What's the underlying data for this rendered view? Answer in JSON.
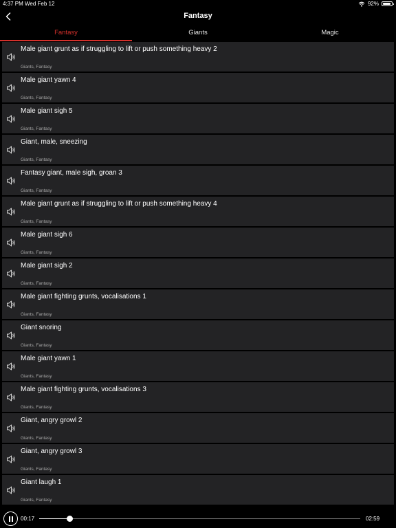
{
  "status_bar": {
    "time": "4:37 PM",
    "date": "Wed Feb 12",
    "battery": "92%",
    "battery_level": 0.92
  },
  "nav": {
    "title": "Fantasy",
    "back_icon": "chevron-left-icon"
  },
  "tabs": [
    {
      "label": "Fantasy",
      "active": true
    },
    {
      "label": "Giants",
      "active": false
    },
    {
      "label": "Magic",
      "active": false
    }
  ],
  "colors": {
    "accent": "#d6312c",
    "row_background": "#232325",
    "background": "#000000"
  },
  "sounds": [
    {
      "title": "Male giant grunt as if struggling to lift or push something heavy 2",
      "tags": "Giants, Fantasy"
    },
    {
      "title": "Male giant yawn 4",
      "tags": "Giants, Fantasy"
    },
    {
      "title": "Male giant sigh 5",
      "tags": "Giants, Fantasy"
    },
    {
      "title": "Giant, male, sneezing",
      "tags": "Giants, Fantasy"
    },
    {
      "title": "Fantasy giant, male sigh, groan 3",
      "tags": "Giants, Fantasy"
    },
    {
      "title": "Male giant grunt as if struggling to lift or push something heavy 4",
      "tags": "Giants, Fantasy"
    },
    {
      "title": "Male giant sigh 6",
      "tags": "Giants, Fantasy"
    },
    {
      "title": "Male giant sigh 2",
      "tags": "Giants, Fantasy"
    },
    {
      "title": "Male giant fighting grunts, vocalisations 1",
      "tags": "Giants, Fantasy"
    },
    {
      "title": "Giant snoring",
      "tags": "Giants, Fantasy"
    },
    {
      "title": "Male giant yawn 1",
      "tags": "Giants, Fantasy"
    },
    {
      "title": "Male giant fighting grunts, vocalisations 3",
      "tags": "Giants, Fantasy"
    },
    {
      "title": "Giant, angry growl 2",
      "tags": "Giants, Fantasy"
    },
    {
      "title": "Giant, angry growl 3",
      "tags": "Giants, Fantasy"
    },
    {
      "title": "Giant laugh 1",
      "tags": "Giants, Fantasy"
    }
  ],
  "player": {
    "elapsed": "00:17",
    "total": "02:59",
    "progress": 0.095,
    "pause_icon": "pause-icon"
  }
}
